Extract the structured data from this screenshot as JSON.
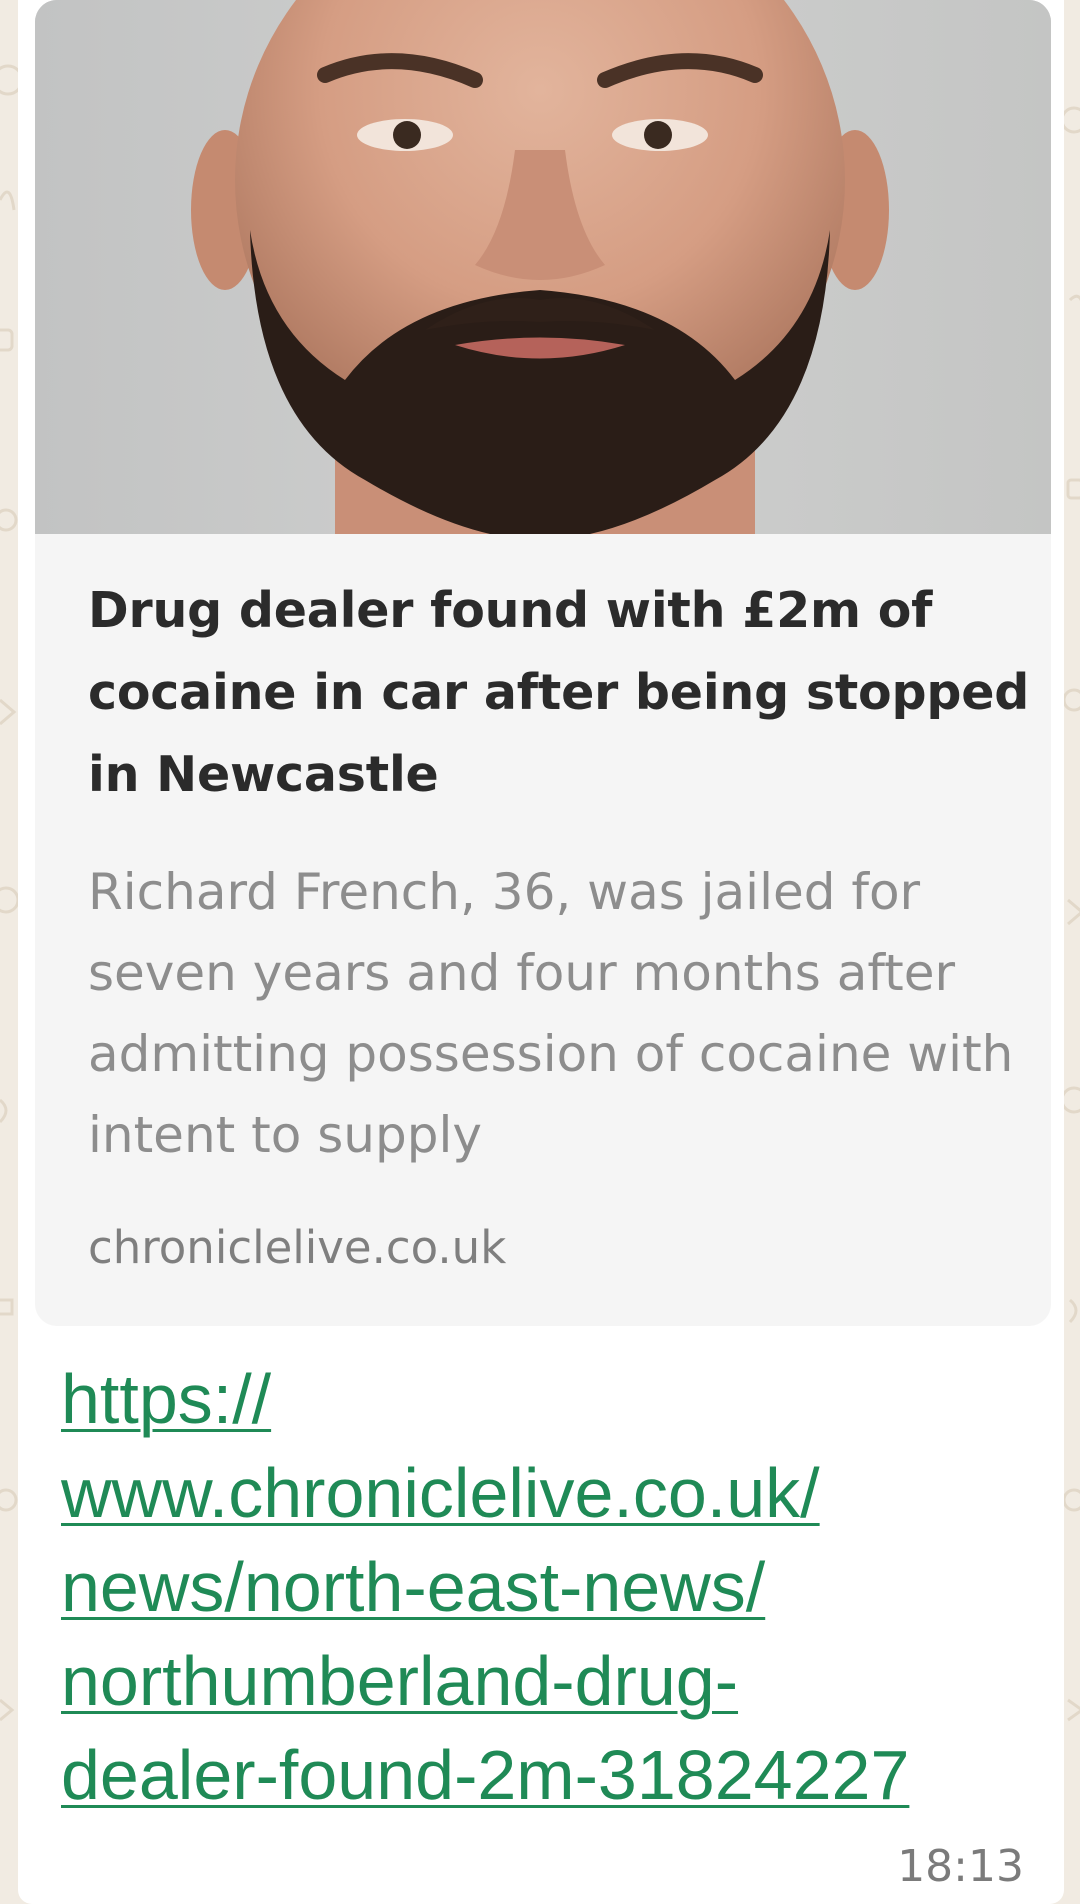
{
  "message": {
    "link_preview": {
      "image_alt": "mugshot-photo",
      "title": "Drug dealer found with £2m of cocaine in car after being stopped in Newcastle",
      "description": "Richard French, 36, was jailed for seven years and four months after admitting possession of cocaine with intent to supply",
      "domain": "chroniclelive.co.uk"
    },
    "link_lines": [
      "https://",
      "www.chroniclelive.co.uk/",
      "news/north-east-news/",
      "northumberland-drug-",
      "dealer-found-2m-31824227"
    ],
    "timestamp": "18:13"
  },
  "colors": {
    "link": "#1f8a56",
    "bubble": "#ffffff",
    "preview_bg": "#f5f5f5",
    "wallpaper": "#f1ebe2"
  }
}
